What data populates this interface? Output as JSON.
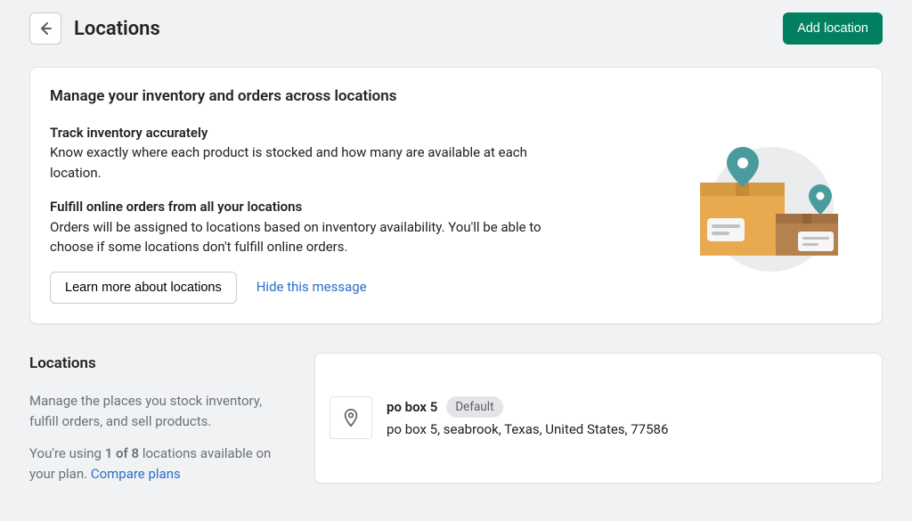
{
  "header": {
    "title": "Locations",
    "add_button": "Add location"
  },
  "info_card": {
    "title": "Manage your inventory and orders across locations",
    "section1_heading": "Track inventory accurately",
    "section1_body": "Know exactly where each product is stocked and how many are available at each location.",
    "section2_heading": "Fulfill online orders from all your locations",
    "section2_body": "Orders will be assigned to locations based on inventory availability. You'll be able to choose if some locations don't fulfill online orders.",
    "learn_button": "Learn more about locations",
    "hide_link": "Hide this message"
  },
  "sidebar": {
    "title": "Locations",
    "desc": "Manage the places you stock inventory, fulfill orders, and sell products.",
    "usage_prefix": "You're using ",
    "usage_count": "1 of 8",
    "usage_suffix": " locations available on your plan. ",
    "compare_link": "Compare plans"
  },
  "location": {
    "name": "po box 5",
    "badge": "Default",
    "address": "po box 5, seabrook, Texas, United States, 77586"
  }
}
